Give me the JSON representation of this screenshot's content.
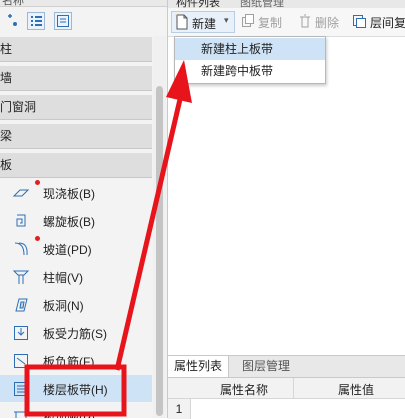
{
  "left": {
    "header_fragment": "名称",
    "categories": [
      "柱",
      "墙",
      "门窗洞",
      "梁",
      "板"
    ],
    "items": [
      {
        "label": "现浇板(B)",
        "icon": "cast-slab-icon",
        "marked": true
      },
      {
        "label": "螺旋板(B)",
        "icon": "spiral-slab-icon",
        "marked": false
      },
      {
        "label": "坡道(PD)",
        "icon": "ramp-icon",
        "marked": true
      },
      {
        "label": "柱帽(V)",
        "icon": "column-cap-icon",
        "marked": false
      },
      {
        "label": "板洞(N)",
        "icon": "slab-hole-icon",
        "marked": false
      },
      {
        "label": "板受力筋(S)",
        "icon": "slab-rebar-icon",
        "marked": false
      },
      {
        "label": "板负筋(F)",
        "icon": "negative-rebar-icon",
        "marked": false
      },
      {
        "label": "楼层板带(H)",
        "icon": "floor-slab-strip-icon",
        "marked": false,
        "selected": true
      },
      {
        "label": "板加腋(P)",
        "icon": "slab-haunch-icon",
        "marked": false
      }
    ]
  },
  "right": {
    "top_tabs": [
      "构件列表",
      "图纸管理"
    ],
    "toolbar": {
      "new_label": "新建",
      "copy_label": "复制",
      "delete_label": "删除",
      "layer_copy_label": "层间复"
    },
    "dropdown": [
      "新建柱上板带",
      "新建跨中板带"
    ],
    "bottom_tabs": [
      "属性列表",
      "图层管理"
    ],
    "table_headers": [
      "属性名称",
      "属性值"
    ],
    "row_number": "1"
  },
  "colors": {
    "annotation_red": "#e8141b",
    "selection_blue": "#cfe3f6",
    "icon_blue": "#2d6fb5"
  }
}
